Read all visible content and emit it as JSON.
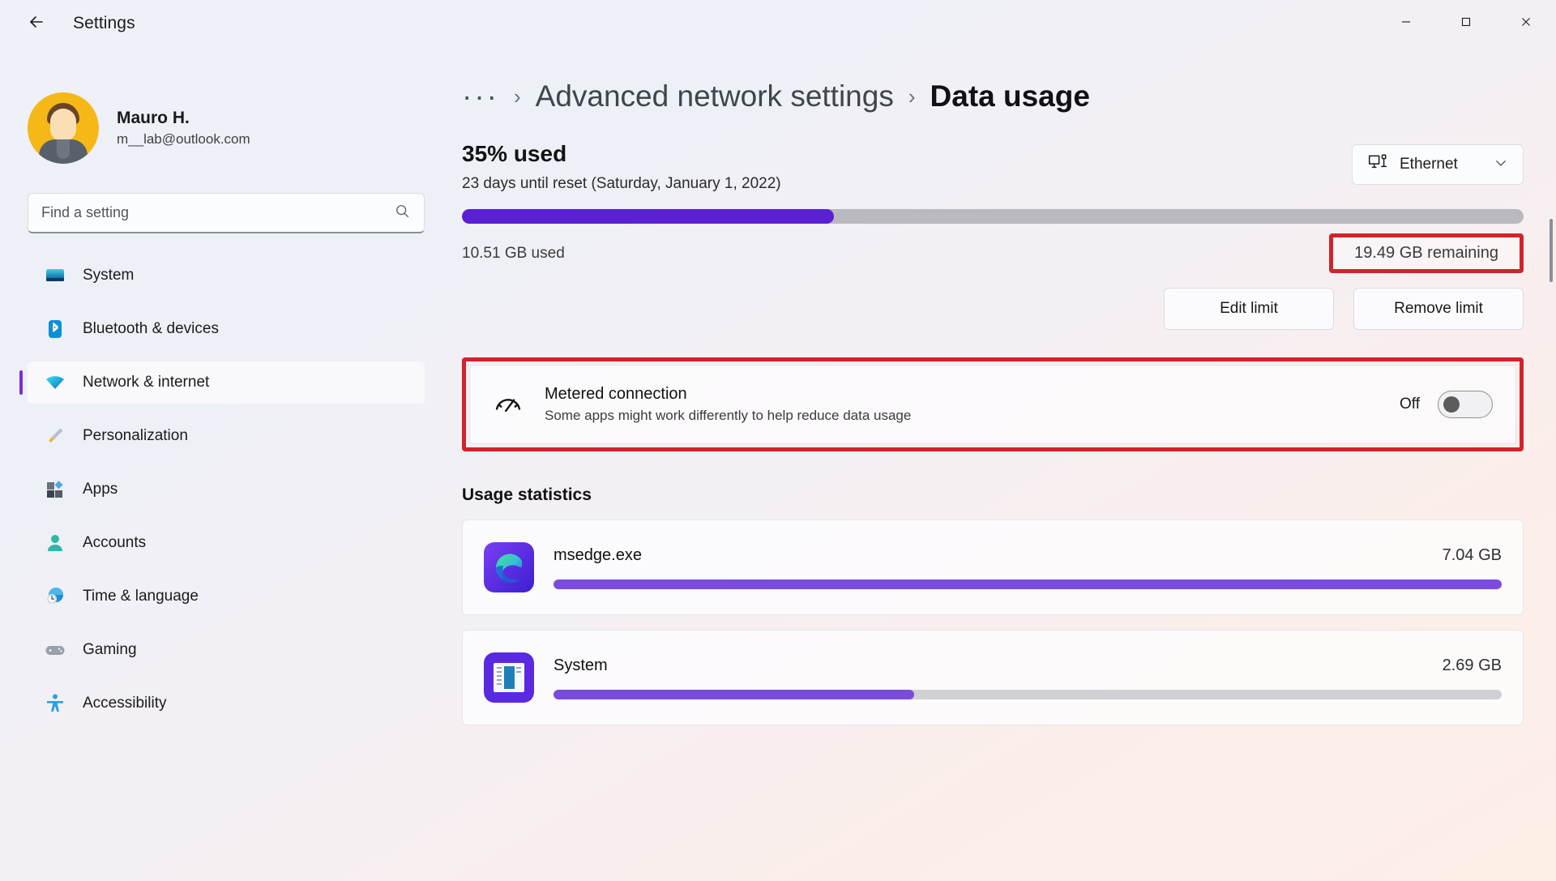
{
  "window": {
    "app_title": "Settings",
    "back_icon": "back-arrow-icon",
    "minimize_label": "─",
    "maximize_label": "□",
    "close_label": "✕"
  },
  "account": {
    "name": "Mauro H.",
    "email": "m__lab@outlook.com"
  },
  "search": {
    "placeholder": "Find a setting",
    "value": ""
  },
  "sidebar": {
    "items": [
      {
        "label": "System",
        "icon": "monitor-icon",
        "selected": false
      },
      {
        "label": "Bluetooth & devices",
        "icon": "bluetooth-icon",
        "selected": false
      },
      {
        "label": "Network & internet",
        "icon": "wifi-icon",
        "selected": true
      },
      {
        "label": "Personalization",
        "icon": "brush-icon",
        "selected": false
      },
      {
        "label": "Apps",
        "icon": "apps-icon",
        "selected": false
      },
      {
        "label": "Accounts",
        "icon": "person-icon",
        "selected": false
      },
      {
        "label": "Time & language",
        "icon": "clock-globe-icon",
        "selected": false
      },
      {
        "label": "Gaming",
        "icon": "gamepad-icon",
        "selected": false
      },
      {
        "label": "Accessibility",
        "icon": "accessibility-icon",
        "selected": false
      }
    ]
  },
  "breadcrumb": {
    "overflow": "···",
    "separator": "›",
    "parent": "Advanced network settings",
    "current": "Data usage"
  },
  "data_usage": {
    "percent_used_label": "35% used",
    "percent_used_value": 35,
    "reset_note": "23 days until reset (Saturday, January 1, 2022)",
    "used_label": "10.51 GB used",
    "remaining_label": "19.49 GB remaining",
    "adapter": "Ethernet",
    "adapter_icon": "network-monitor-icon",
    "chevron_icon": "chevron-down-icon",
    "edit_limit_label": "Edit limit",
    "remove_limit_label": "Remove limit",
    "bar_fill_color": "#5b20d4",
    "bar_track_color": "#b9b9bf",
    "highlight_color": "#d3232a"
  },
  "metered": {
    "title": "Metered connection",
    "subtitle": "Some apps might work differently to help reduce data usage",
    "icon": "speedometer-icon",
    "state_label": "Off",
    "state_on": false
  },
  "usage_statistics": {
    "section_title": "Usage statistics",
    "apps": [
      {
        "name": "msedge.exe",
        "size": "7.04 GB",
        "icon": "edge-icon",
        "percent": 100
      },
      {
        "name": "System",
        "size": "2.69 GB",
        "icon": "system-window-icon",
        "percent": 38
      }
    ]
  }
}
